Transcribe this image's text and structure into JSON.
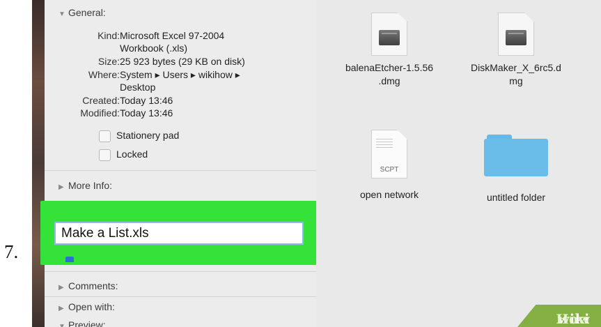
{
  "step_number": "7.",
  "info": {
    "general_header": "General:",
    "kind_key": "Kind:",
    "kind_value_line1": "Microsoft Excel 97-2004",
    "kind_value_line2": "Workbook (.xls)",
    "size_key": "Size:",
    "size_value": "25 923 bytes (29 KB on disk)",
    "where_key": "Where:",
    "where_value_line1": "System ▸ Users ▸ wikihow ▸",
    "where_value_line2": "Desktop",
    "created_key": "Created:",
    "created_value": "Today 13:46",
    "modified_key": "Modified:",
    "modified_value": "Today 13:46",
    "stationery_label": "Stationery pad",
    "locked_label": "Locked",
    "more_info_header": "More Info:",
    "name_value": "Make a List.xls",
    "comments_header": "Comments:",
    "open_with_header": "Open with:",
    "preview_header": "Preview:"
  },
  "files": [
    {
      "label_line1": "balenaEtcher-1.5.56",
      "label_line2": ".dmg",
      "icon": "disk-image-icon"
    },
    {
      "label_line1": "DiskMaker_X_6rc5.d",
      "label_line2": "mg",
      "icon": "disk-image-icon"
    },
    {
      "label_line1": "open network",
      "label_line2": "",
      "icon": "script-icon",
      "icon_tag": "SCPT"
    },
    {
      "label_line1": "untitled folder",
      "label_line2": "",
      "icon": "folder-icon"
    }
  ],
  "watermark": {
    "wiki": "wiki",
    "how": "How"
  },
  "colors": {
    "highlight": "#34e23a",
    "folder": "#6bbde9",
    "field_border": "#8fb8ee"
  }
}
